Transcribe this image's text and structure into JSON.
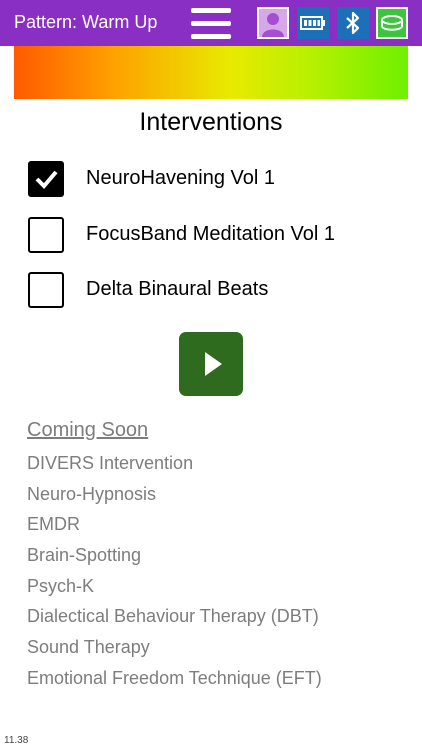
{
  "header": {
    "title": "Pattern: Warm Up",
    "colors": {
      "bar": "#8a2fc4",
      "status_blue": "#1d6fb8",
      "status_green": "#3ec43e"
    },
    "icons": [
      "menu-icon",
      "profile-icon",
      "battery-icon",
      "bluetooth-icon",
      "focusband-icon"
    ]
  },
  "main": {
    "heading": "Interventions",
    "interventions": [
      {
        "label": "NeuroHavening Vol 1",
        "checked": true
      },
      {
        "label": "FocusBand Meditation Vol 1",
        "checked": false
      },
      {
        "label": "Delta Binaural Beats",
        "checked": false
      }
    ],
    "play_icon": "play-icon",
    "play_color": "#2e6b1f"
  },
  "coming_soon": {
    "title": "Coming Soon",
    "items": [
      "DIVERS Intervention",
      "Neuro-Hypnosis",
      "EMDR",
      "Brain-Spotting",
      "Psych-K",
      "Dialectical Behaviour Therapy (DBT)",
      "Sound Therapy",
      "Emotional Freedom Technique (EFT)"
    ]
  },
  "footer": {
    "time": "11.38"
  }
}
